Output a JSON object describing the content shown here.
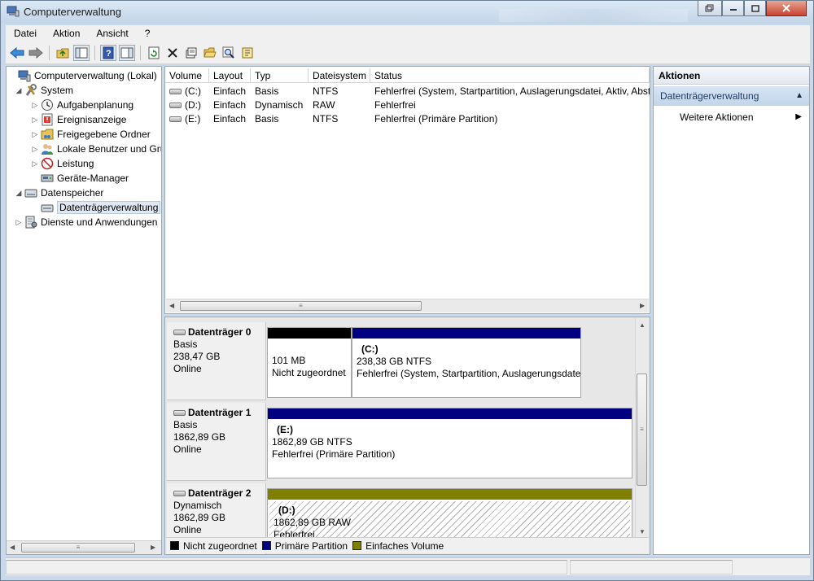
{
  "window": {
    "title": "Computerverwaltung"
  },
  "menu": [
    "Datei",
    "Aktion",
    "Ansicht",
    "?"
  ],
  "tree": {
    "root": "Computerverwaltung (Lokal)",
    "system": "System",
    "aufgaben": "Aufgabenplanung",
    "ereignis": "Ereignisanzeige",
    "freigaben": "Freigegebene Ordner",
    "benutzer": "Lokale Benutzer und Gruppen",
    "leistung": "Leistung",
    "geraete": "Geräte-Manager",
    "datenspeicher": "Datenspeicher",
    "datentraeger": "Datenträgerverwaltung",
    "dienste": "Dienste und Anwendungen"
  },
  "volumes": {
    "headers": {
      "volume": "Volume",
      "layout": "Layout",
      "typ": "Typ",
      "fs": "Dateisystem",
      "status": "Status"
    },
    "rows": [
      {
        "volume": "(C:)",
        "layout": "Einfach",
        "typ": "Basis",
        "fs": "NTFS",
        "status": "Fehlerfrei (System, Startpartition, Auslagerungsdatei, Aktiv, Absturzabbild)"
      },
      {
        "volume": "(D:)",
        "layout": "Einfach",
        "typ": "Dynamisch",
        "fs": "RAW",
        "status": "Fehlerfrei"
      },
      {
        "volume": "(E:)",
        "layout": "Einfach",
        "typ": "Basis",
        "fs": "NTFS",
        "status": "Fehlerfrei (Primäre Partition)"
      }
    ]
  },
  "disks": [
    {
      "name": "Datenträger 0",
      "type": "Basis",
      "size": "238,47 GB",
      "state": "Online",
      "parts": [
        {
          "name": "",
          "size": "101 MB",
          "status": "Nicht zugeordnet"
        },
        {
          "name": "(C:)",
          "size": "238,38 GB NTFS",
          "status": "Fehlerfrei (System, Startpartition, Auslagerungsdatei)"
        }
      ]
    },
    {
      "name": "Datenträger 1",
      "type": "Basis",
      "size": "1862,89 GB",
      "state": "Online",
      "parts": [
        {
          "name": "(E:)",
          "size": "1862,89 GB NTFS",
          "status": "Fehlerfrei (Primäre Partition)"
        }
      ]
    },
    {
      "name": "Datenträger 2",
      "type": "Dynamisch",
      "size": "1862,89 GB",
      "state": "Online",
      "parts": [
        {
          "name": "(D:)",
          "size": "1862,89 GB RAW",
          "status": "Fehlerfrei"
        }
      ]
    }
  ],
  "legend": [
    {
      "label": "Nicht zugeordnet",
      "color": "#000000"
    },
    {
      "label": "Primäre Partition",
      "color": "#000080"
    },
    {
      "label": "Einfaches Volume",
      "color": "#808000"
    }
  ],
  "actions": {
    "title": "Aktionen",
    "section": "Datenträgerverwaltung",
    "item": "Weitere Aktionen"
  },
  "icons": [
    "back-arrow-icon",
    "forward-arrow-icon",
    "up-folder-icon",
    "show-hide-tree-icon",
    "help-icon",
    "properties-icon",
    "refresh-icon",
    "delete-icon",
    "settings-icon",
    "open-folder-icon",
    "search-icon",
    "wizard-icon"
  ]
}
